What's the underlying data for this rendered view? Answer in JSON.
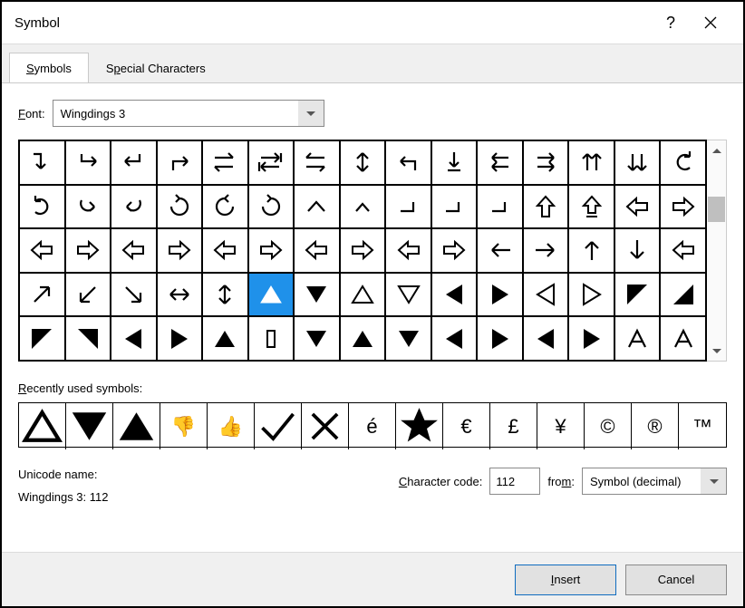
{
  "title": "Symbol",
  "tabs": {
    "symbols": "Symbols",
    "special": "Special Characters"
  },
  "labels": {
    "font": "Font:",
    "recent": "Recently used symbols:",
    "unicode_name": "Unicode name:",
    "charcode": "Character code:",
    "from": "from:"
  },
  "font": {
    "value": "Wingdings 3"
  },
  "grid": [
    "↴",
    "↳",
    "↲",
    "↱",
    "⇄",
    "↹",
    "⇆",
    "↕",
    "↰",
    "↧",
    "⇇",
    "⇉",
    "⇈",
    "⇊",
    "↶",
    "↷",
    "↪",
    "↩",
    "↻",
    "↺",
    "↻",
    "⌃",
    "^",
    "⌐",
    "⌐",
    "⌐",
    "⇧",
    "⇮",
    "⇦",
    "⇨",
    "⇦",
    "⇨",
    "⇦",
    "⇨",
    "⇦",
    "⇨",
    "⇦",
    "⇨",
    "⇦",
    "⇨",
    "←",
    "→",
    "↑",
    "↓",
    "⇦",
    "↗",
    "↙",
    "↘",
    "↔",
    "↕",
    "▲",
    "▼",
    "△",
    "▽",
    "◀",
    "▶",
    "◁",
    "▷",
    "◤",
    "◢",
    "◤",
    "◥",
    "◀",
    "▶",
    "▲",
    "▯",
    "▼",
    "▲",
    "▼",
    "◀",
    "▶",
    "◀",
    "▶",
    "A",
    "A"
  ],
  "selected_index": 50,
  "recent": [
    "Δ",
    "▼",
    "▲",
    "👎",
    "👍",
    "✓",
    "✗",
    "é",
    "★",
    "€",
    "£",
    "¥",
    "©",
    "®",
    "™"
  ],
  "unicode_display": "Wingdings 3: 112",
  "charcode": "112",
  "from": "Symbol (decimal)",
  "buttons": {
    "insert": "Insert",
    "cancel": "Cancel"
  }
}
